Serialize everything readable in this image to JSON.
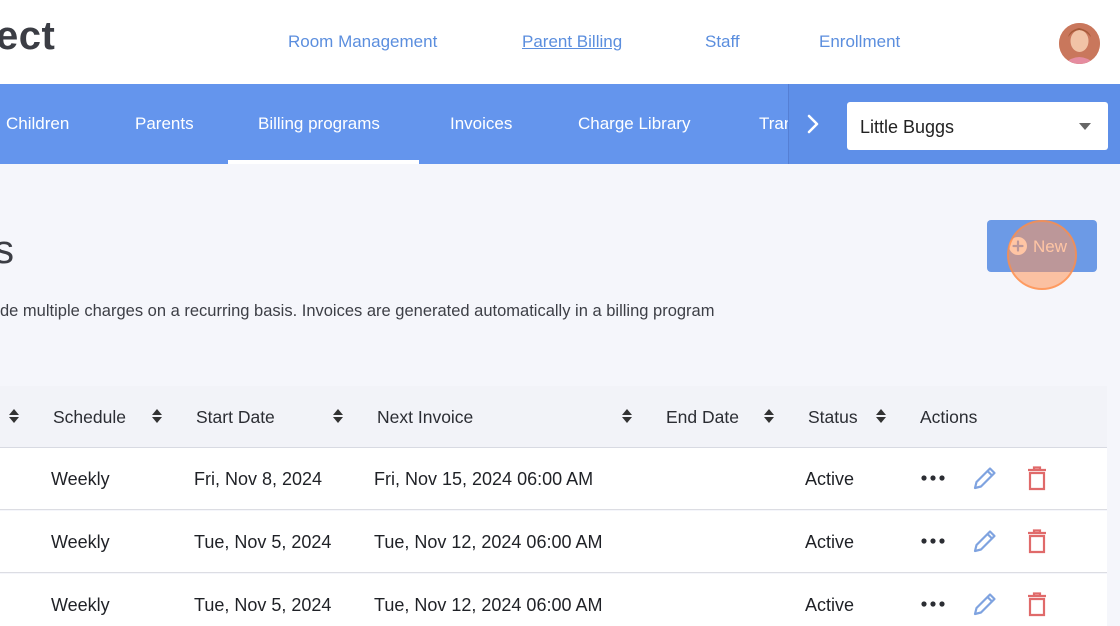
{
  "header": {
    "logo": "ect",
    "nav": [
      {
        "label": "Room Management",
        "active": false
      },
      {
        "label": "Parent Billing",
        "active": true
      },
      {
        "label": "Staff",
        "active": false
      },
      {
        "label": "Enrollment",
        "active": false
      }
    ]
  },
  "subnav": {
    "tabs": [
      {
        "label": "Children"
      },
      {
        "label": "Parents"
      },
      {
        "label": "Billing programs",
        "active": true
      },
      {
        "label": "Invoices"
      },
      {
        "label": "Charge Library"
      },
      {
        "label": "Transactions"
      }
    ],
    "center": {
      "selected": "Little Buggs"
    }
  },
  "page": {
    "title": "s",
    "description": "de multiple charges on a recurring basis. Invoices are generated automatically in a billing program",
    "new_label": "New"
  },
  "table": {
    "columns": [
      "Schedule",
      "Start Date",
      "Next Invoice",
      "End Date",
      "Status",
      "Actions"
    ],
    "rows": [
      {
        "schedule": "Weekly",
        "start": "Fri, Nov 8, 2024",
        "next": "Fri, Nov 15, 2024 06:00 AM",
        "end": "",
        "status": "Active"
      },
      {
        "schedule": "Weekly",
        "start": "Tue, Nov 5, 2024",
        "next": "Tue, Nov 12, 2024 06:00 AM",
        "end": "",
        "status": "Active"
      },
      {
        "schedule": "Weekly",
        "start": "Tue, Nov 5, 2024",
        "next": "Tue, Nov 12, 2024 06:00 AM",
        "end": "",
        "status": "Active"
      }
    ]
  },
  "colors": {
    "accent": "#6495ed",
    "link": "#5b8ede",
    "delete": "#e06a6a",
    "edit": "#7fa3e0"
  }
}
